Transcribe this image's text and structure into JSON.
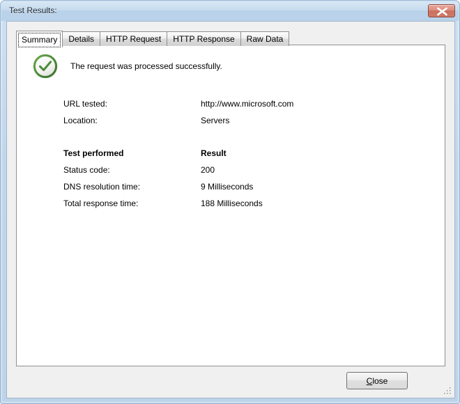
{
  "window": {
    "title": "Test Results:",
    "close_icon": "close-x-icon"
  },
  "tabs": [
    {
      "label": "Summary",
      "selected": true
    },
    {
      "label": "Details",
      "selected": false
    },
    {
      "label": "HTTP Request",
      "selected": false
    },
    {
      "label": "HTTP Response",
      "selected": false
    },
    {
      "label": "Raw Data",
      "selected": false
    }
  ],
  "summary": {
    "status_icon": "success-check-circle-icon",
    "status_message": "The request was processed successfully.",
    "fields": [
      {
        "label": "URL tested:",
        "value": "http://www.microsoft.com"
      },
      {
        "label": "Location:",
        "value": "Servers"
      }
    ],
    "table": {
      "header": {
        "label": "Test performed",
        "value": "Result"
      },
      "rows": [
        {
          "label": "Status code:",
          "value": "200"
        },
        {
          "label": "DNS resolution time:",
          "value": "9 Milliseconds"
        },
        {
          "label": "Total response time:",
          "value": "188 Milliseconds"
        }
      ]
    }
  },
  "footer": {
    "close_accel": "C",
    "close_rest": "lose"
  },
  "colors": {
    "titlebar_top": "#d8e7f4",
    "titlebar_bottom": "#bad3ea",
    "frame": "#c2d6ea",
    "dialog_bg": "#f0f0f0",
    "panel_bg": "#ffffff",
    "success_green": "#4d8b3c",
    "close_button_red": "#cf7a68"
  }
}
